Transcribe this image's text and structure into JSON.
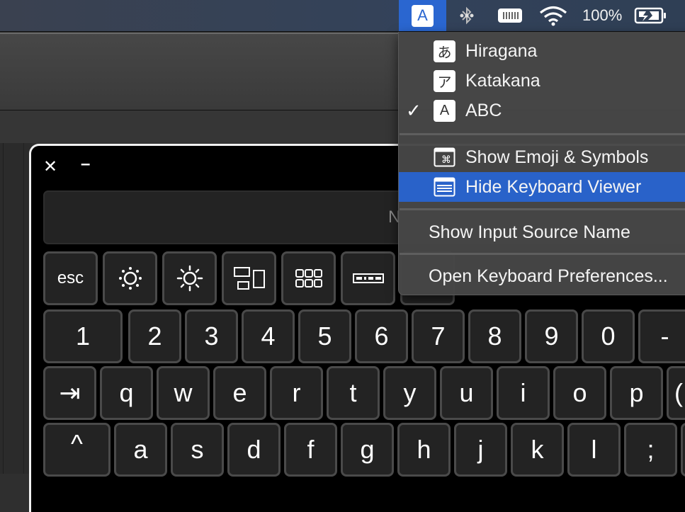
{
  "menubar": {
    "input_source_letter": "A",
    "battery_percent": "100%",
    "icons": [
      "input-source-icon",
      "bluetooth-icon",
      "keyboard-status-icon",
      "wifi-icon",
      "battery-charging-icon"
    ]
  },
  "input_menu": {
    "items": [
      {
        "label": "Hiragana",
        "icon_glyph": "あ",
        "checked": false
      },
      {
        "label": "Katakana",
        "icon_glyph": "ア",
        "checked": false
      },
      {
        "label": "ABC",
        "icon_glyph": "A",
        "checked": true,
        "check_glyph": "✓"
      },
      {
        "label": "Show Emoji & Symbols",
        "icon": "emoji-symbols-icon"
      },
      {
        "label": "Hide Keyboard Viewer",
        "icon": "keyboard-viewer-icon",
        "highlighted": true
      },
      {
        "label": "Show Input Source Name"
      },
      {
        "label": "Open Keyboard Preferences..."
      }
    ]
  },
  "keyboard_viewer": {
    "close_glyph": "✕",
    "minimize_glyph": "–",
    "touchbar_text": "N",
    "function_row": [
      {
        "label": "esc"
      },
      {
        "icon": "brightness-down-icon"
      },
      {
        "icon": "brightness-up-icon"
      },
      {
        "icon": "mission-control-icon"
      },
      {
        "icon": "launchpad-icon"
      },
      {
        "icon": "keyboard-backlight-icon"
      }
    ],
    "number_row": [
      "1",
      "2",
      "3",
      "4",
      "5",
      "6",
      "7",
      "8",
      "9",
      "0",
      "-"
    ],
    "qwerty_row": [
      "⇥",
      "q",
      "w",
      "e",
      "r",
      "t",
      "y",
      "u",
      "i",
      "o",
      "p",
      "("
    ],
    "home_row": [
      "^",
      "a",
      "s",
      "d",
      "f",
      "g",
      "h",
      "j",
      "k",
      "l",
      ";"
    ]
  }
}
